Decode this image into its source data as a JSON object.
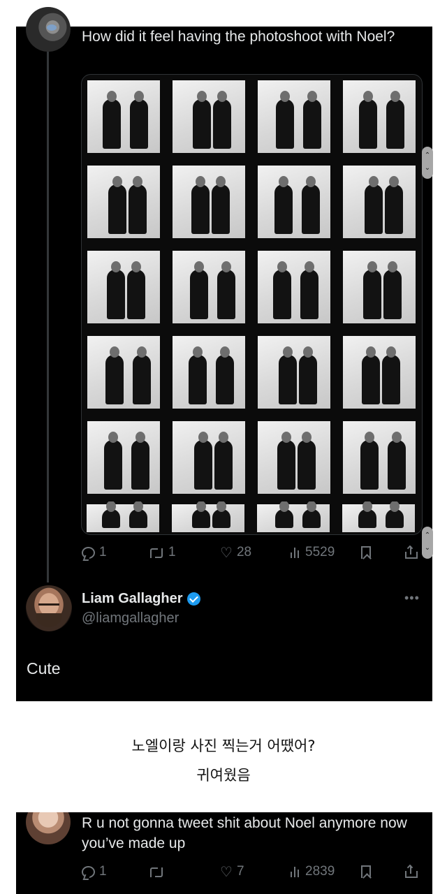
{
  "tweet1": {
    "text": "How did it feel having the photoshoot with Noel?",
    "actions": {
      "replies": "1",
      "reposts": "1",
      "likes": "28",
      "views": "5529"
    }
  },
  "reply": {
    "author_name": "Liam Gallagher",
    "author_handle": "@liamgallagher",
    "text": "Cute"
  },
  "caption": {
    "line1": "노엘이랑 사진 찍는거 어땠어?",
    "line2": "귀여웠음"
  },
  "tweet2": {
    "text": "R u not gonna tweet shit about Noel anymore now you’ve made up",
    "actions": {
      "replies": "1",
      "reposts": "",
      "likes": "7",
      "views": "2839"
    }
  },
  "colors": {
    "accent": "#1d9bf0",
    "muted": "#71767b",
    "background": "#000000"
  },
  "icons": [
    "reply-icon",
    "repost-icon",
    "heart-icon",
    "views-icon",
    "bookmark-icon",
    "share-icon",
    "verified-badge-icon",
    "more-icon"
  ]
}
